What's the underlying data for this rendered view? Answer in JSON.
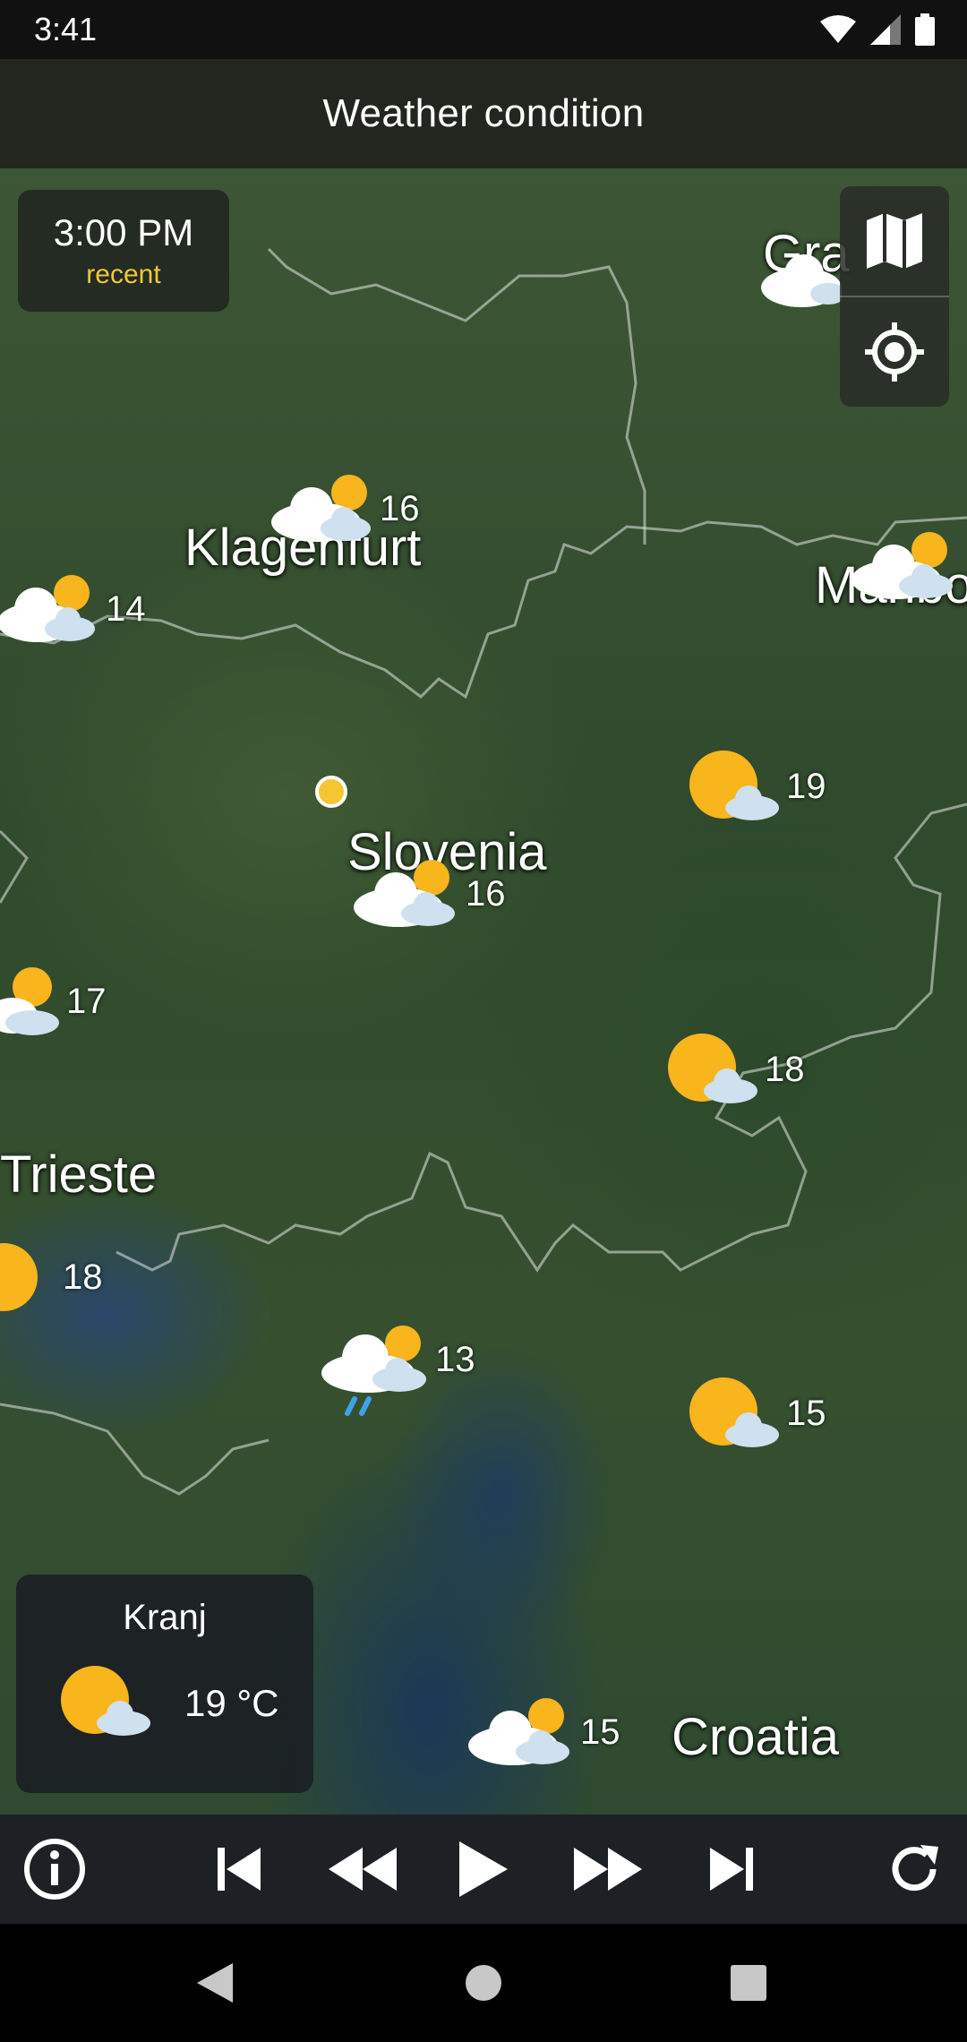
{
  "status_bar": {
    "time": "3:41"
  },
  "app_bar": {
    "title": "Weather condition"
  },
  "time_box": {
    "time": "3:00 PM",
    "label": "recent"
  },
  "place_labels": {
    "klagenfurt": "Klagenfurt",
    "slovenia": "Slovenia",
    "trieste": "Trieste",
    "croatia": "Croatia",
    "graz": "Gra",
    "maribor": "Maribo"
  },
  "markers": [
    {
      "temp": "16",
      "condition": "partly-cloudy-icon"
    },
    {
      "temp": "14",
      "condition": "partly-cloudy-icon"
    },
    {
      "temp": "19",
      "condition": "mostly-sunny-icon"
    },
    {
      "temp": "16",
      "condition": "partly-cloudy-icon"
    },
    {
      "temp": "17",
      "condition": "partly-cloudy-icon"
    },
    {
      "temp": "18",
      "condition": "mostly-sunny-icon"
    },
    {
      "temp": "18",
      "condition": "sunny-icon"
    },
    {
      "temp": "13",
      "condition": "cloudy-rain-icon"
    },
    {
      "temp": "15",
      "condition": "mostly-sunny-icon"
    },
    {
      "temp": "15",
      "condition": "partly-cloudy-icon"
    }
  ],
  "city_card": {
    "name": "Kranj",
    "temp": "19 °C",
    "condition": "mostly-sunny-icon"
  },
  "colors": {
    "sun": "#f8b51c",
    "cloud": "#ffffff",
    "cloud_shade": "#cfe0ee",
    "accent": "#f2c73a"
  }
}
